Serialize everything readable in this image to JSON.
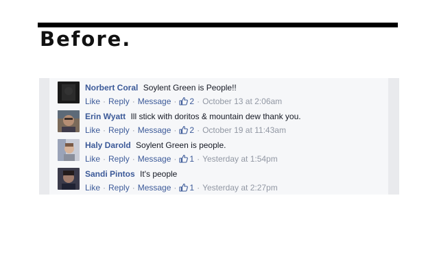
{
  "heading": "Before.",
  "comments": [
    {
      "author": "Norbert Coral",
      "text": "Soylent Green is People!!",
      "like_label": "Like",
      "reply_label": "Reply",
      "message_label": "Message",
      "likes": "2",
      "timestamp": "October 13 at 2:06am"
    },
    {
      "author": "Erin Wyatt",
      "text": "Ill stick with doritos & mountain dew thank you.",
      "like_label": "Like",
      "reply_label": "Reply",
      "message_label": "Message",
      "likes": "2",
      "timestamp": "October 19 at 11:43am"
    },
    {
      "author": "Haly Darold",
      "text": "Soylent Green is people.",
      "like_label": "Like",
      "reply_label": "Reply",
      "message_label": "Message",
      "likes": "1",
      "timestamp": "Yesterday at 1:54pm"
    },
    {
      "author": "Sandi Pintos",
      "text": "It's people",
      "like_label": "Like",
      "reply_label": "Reply",
      "message_label": "Message",
      "likes": "1",
      "timestamp": "Yesterday at 2:27pm"
    }
  ],
  "colors": {
    "link": "#3b5998",
    "meta": "#9197a3",
    "panel_bg": "#f6f7f9",
    "panel_border": "#e9eaed"
  },
  "icons": {
    "like_count": "thumbs-up-icon",
    "avatar": "user-photo"
  }
}
